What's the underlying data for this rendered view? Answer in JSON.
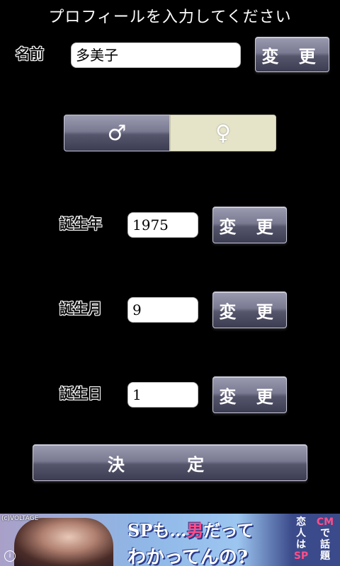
{
  "header": {
    "title": "プロフィールを入力してください"
  },
  "name": {
    "label": "名前",
    "value": "多美子",
    "button_label": "変 更"
  },
  "gender": {
    "male_symbol": "♂",
    "female_symbol": "♀",
    "selected": "female"
  },
  "birth_year": {
    "label": "誕生年",
    "value": "1975",
    "button_label": "変 更"
  },
  "birth_month": {
    "label": "誕生月",
    "value": "9",
    "button_label": "変 更"
  },
  "birth_day": {
    "label": "誕生日",
    "value": "1",
    "button_label": "変 更"
  },
  "submit": {
    "label": "決 定"
  },
  "ad": {
    "copyright": "(c)VOLTAGE",
    "line1_a": "SPも…",
    "line1_b": "男",
    "line1_c": "だって",
    "line2": "わかってんの?",
    "side_left": [
      "恋",
      "人",
      "は",
      "SP"
    ],
    "side_right": [
      "CM",
      "で",
      "話",
      "題"
    ],
    "info_icon": "i"
  }
}
